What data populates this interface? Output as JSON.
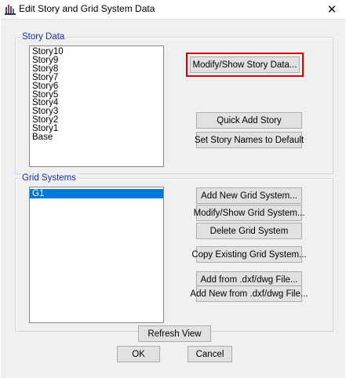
{
  "window": {
    "title": "Edit Story and Grid System Data",
    "icon": "etabs-app-icon",
    "close_glyph": "✕"
  },
  "story_data": {
    "label": "Story Data",
    "stories": [
      "Story10",
      "Story9",
      "Story8",
      "Story7",
      "Story6",
      "Story5",
      "Story4",
      "Story3",
      "Story2",
      "Story1",
      "Base"
    ],
    "buttons": {
      "modify_show": "Modify/Show Story Data...",
      "quick_add": "Quick Add Story",
      "set_default_names": "Set Story Names to Default"
    }
  },
  "grid_systems": {
    "label": "Grid Systems",
    "items": [
      "G1"
    ],
    "selected_index": 0,
    "buttons": {
      "add_new": "Add New Grid System...",
      "modify_show": "Modify/Show Grid System...",
      "delete": "Delete Grid System",
      "copy_existing": "Copy Existing Grid System...",
      "add_from_dxf": "Add  from .dxf/dwg File...",
      "add_new_from_dxf": "Add New from .dxf/dwg File..."
    }
  },
  "footer": {
    "refresh": "Refresh View",
    "ok": "OK",
    "cancel": "Cancel"
  },
  "colors": {
    "group_label": "#1c2fa0",
    "selection": "#0078d7",
    "highlight_outline": "#d00000"
  }
}
